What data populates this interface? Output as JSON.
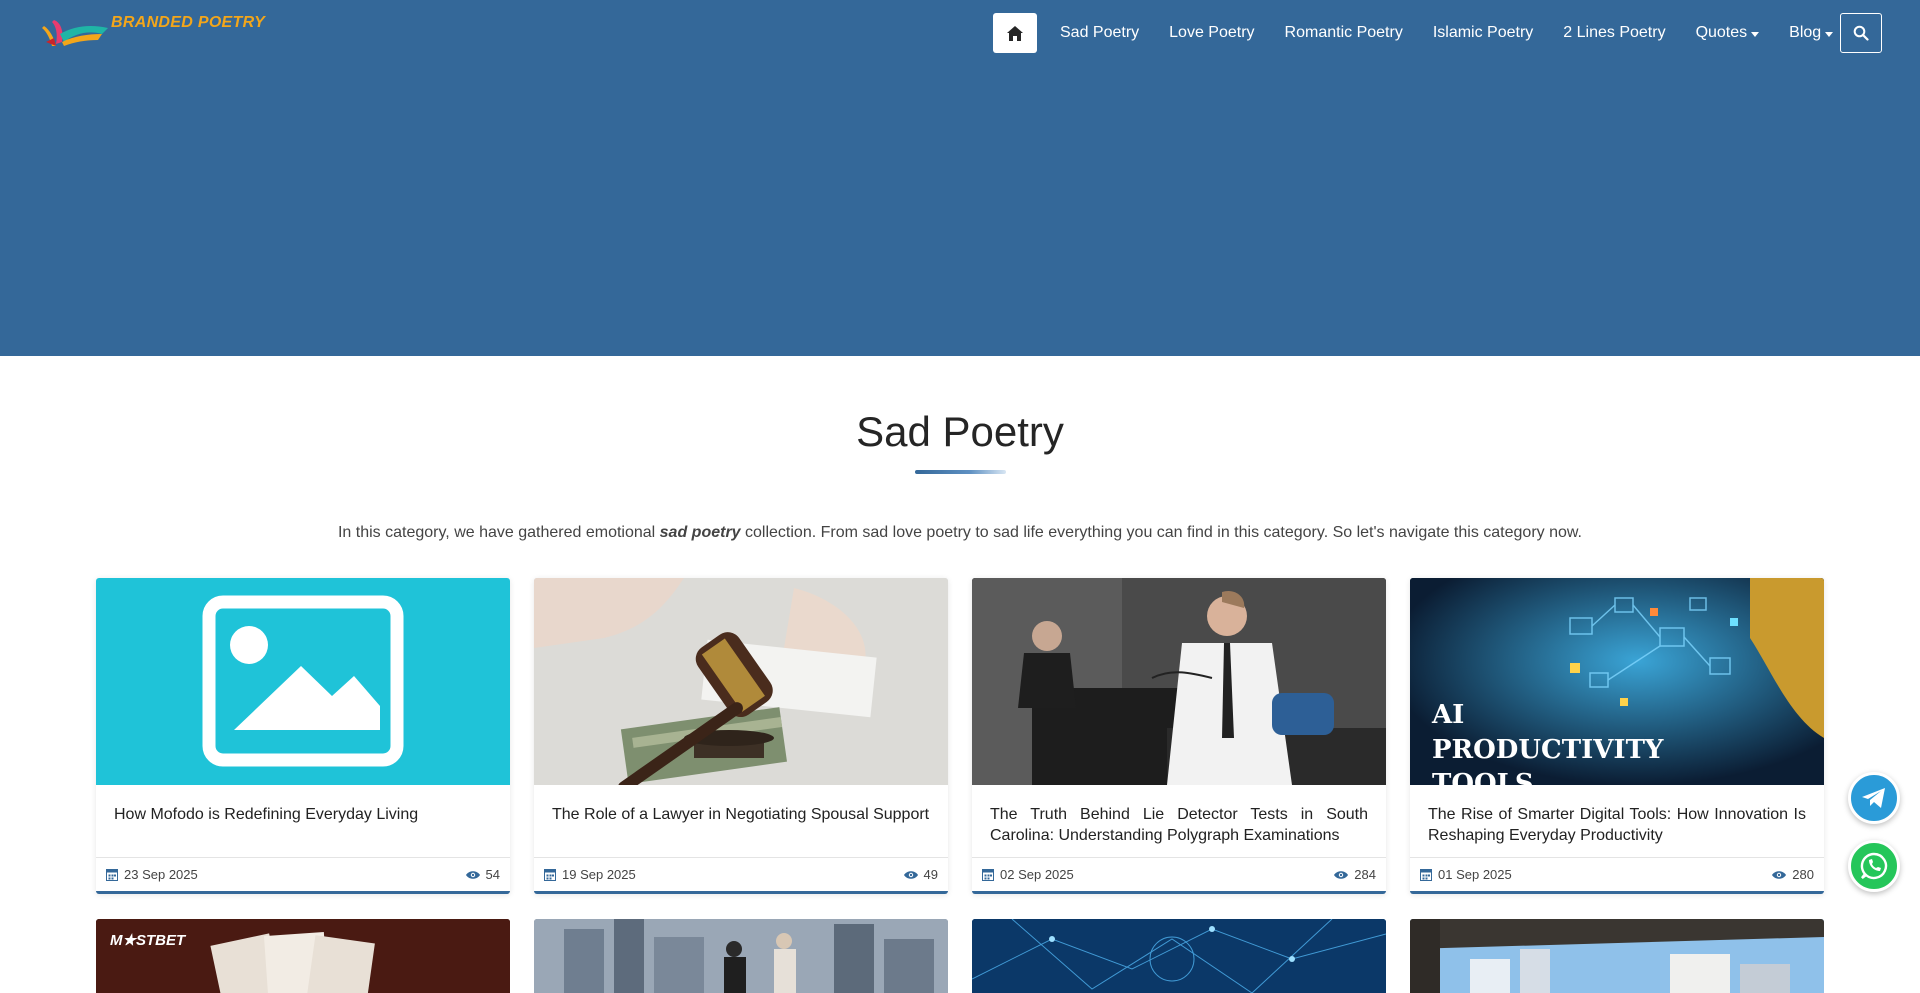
{
  "brand": {
    "name": "BRANDED POETRY"
  },
  "nav": {
    "items": [
      {
        "label": "Sad Poetry",
        "dropdown": false
      },
      {
        "label": "Love Poetry",
        "dropdown": false
      },
      {
        "label": "Romantic Poetry",
        "dropdown": false
      },
      {
        "label": "Islamic Poetry",
        "dropdown": false
      },
      {
        "label": "2 Lines Poetry",
        "dropdown": false
      },
      {
        "label": "Quotes",
        "dropdown": true
      },
      {
        "label": "Blog",
        "dropdown": true
      }
    ],
    "home_icon": "home-icon",
    "search_icon": "search-icon"
  },
  "page": {
    "title": "Sad Poetry",
    "intro_before": "In this category, we have gathered emotional ",
    "intro_emphasis": "sad poetry",
    "intro_after": " collection. From sad love poetry to sad life everything you can find in this category. So let's navigate this category now."
  },
  "cards": [
    {
      "title": "How Mofodo is Redefining Everyday Living",
      "date": "23 Sep 2025",
      "views": "54"
    },
    {
      "title": "The Role of a Lawyer in Negotiating Spousal Support",
      "date": "19 Sep 2025",
      "views": "49"
    },
    {
      "title": "The Truth Behind Lie Detector Tests in South Carolina: Understanding Polygraph Examinations",
      "date": "02 Sep 2025",
      "views": "284"
    },
    {
      "title": "The Rise of Smarter Digital Tools: How Innovation Is Reshaping Everyday Productivity",
      "date": "01 Sep 2025",
      "views": "280"
    }
  ],
  "card_image_text": {
    "ai_line1": "AI",
    "ai_line2": "PRODUCTIVITY",
    "ai_line3": "TOOLS",
    "mostbet": "M★STBET"
  },
  "colors": {
    "header_bg": "#346899",
    "accent": "#346899",
    "logo_text": "#f3a61a",
    "telegram": "#2a9bd8",
    "whatsapp": "#25c65a"
  },
  "floating": {
    "telegram_icon": "telegram-icon",
    "whatsapp_icon": "whatsapp-icon"
  }
}
